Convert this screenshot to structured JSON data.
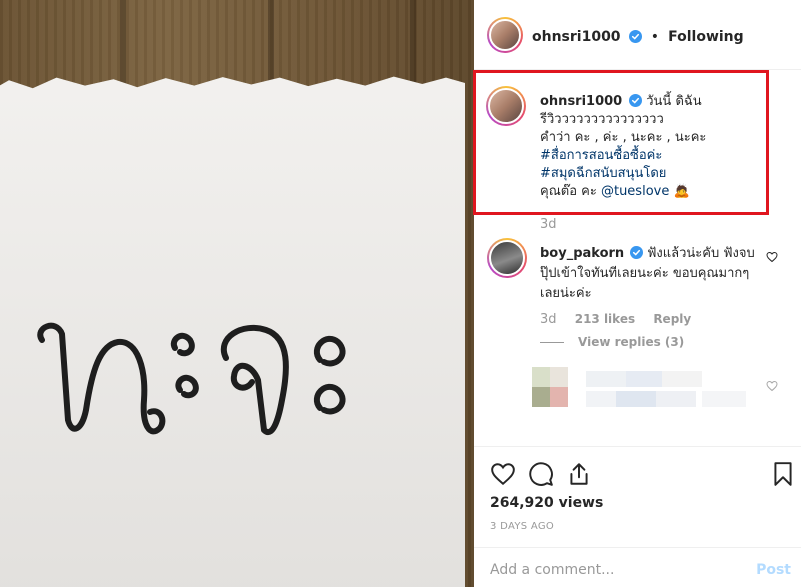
{
  "header": {
    "username": "ohnsri1000",
    "separator": "•",
    "follow_status": "Following"
  },
  "caption": {
    "username": "ohnsri1000",
    "line1": "วันนี้ ดิฉัน",
    "line2": "รีวิววววววววววววววว",
    "line3": "คำว่า คะ , ค่ะ , นะคะ , นะคะ",
    "hashtag1": "#สื่อการสอนซื้อซื้อค่ะ",
    "hashtag2": "#สมุดฉีกสนับสนุนโดย",
    "line6": "คุณต๊อ คะ",
    "mention": "@tueslove",
    "emoji": "🙇",
    "time": "3d"
  },
  "media": {
    "handwritten_text": "นะคะ"
  },
  "comment": {
    "username": "boy_pakorn",
    "text": "ฟังแล้วน่ะคับ ฟังจบปุ๊ปเข้าใจทันทีเลยนะค่ะ ขอบคุณมากๆเลยน่ะค่ะ",
    "time": "3d",
    "likes": "213 likes",
    "reply": "Reply",
    "view_replies": "View replies (3)"
  },
  "actions": {
    "views": "264,920 views",
    "date": "3 DAYS AGO"
  },
  "add_comment": {
    "placeholder": "Add a comment...",
    "post_label": "Post"
  },
  "colors": {
    "highlight_box": "#e0161f",
    "link": "#003569",
    "verified": "#3897f0",
    "post_disabled": "#b3dbff"
  },
  "icons": [
    "verified-icon",
    "heart-icon",
    "comment-icon",
    "share-icon",
    "bookmark-icon",
    "heart-small-icon"
  ]
}
